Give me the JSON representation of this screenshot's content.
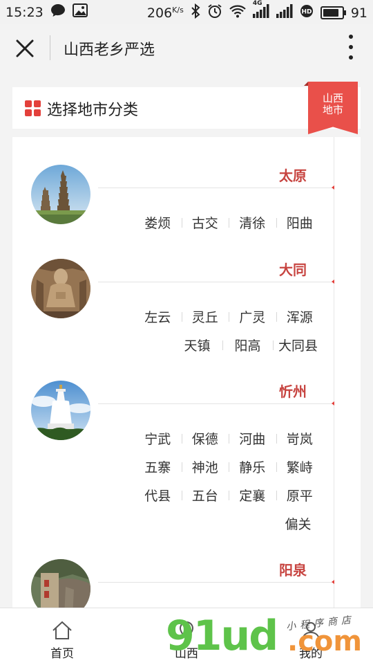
{
  "status_bar": {
    "time": "15:23",
    "speed": "206",
    "speed_unit": "K/s",
    "network": "4G",
    "battery": "91"
  },
  "nav": {
    "title": "山西老乡严选"
  },
  "section": {
    "title": "选择地市分类",
    "ribbon_line1": "山西",
    "ribbon_line2": "地市"
  },
  "cities": [
    {
      "name": "太原",
      "counties": [
        "娄烦",
        "古交",
        "清徐",
        "阳曲"
      ]
    },
    {
      "name": "大同",
      "counties": [
        "左云",
        "灵丘",
        "广灵",
        "浑源",
        "天镇",
        "阳高",
        "大同县"
      ]
    },
    {
      "name": "忻州",
      "counties": [
        "宁武",
        "保德",
        "河曲",
        "岢岚",
        "五寨",
        "神池",
        "静乐",
        "繁峙",
        "代县",
        "五台",
        "定襄",
        "原平",
        "偏关"
      ]
    },
    {
      "name": "阳泉",
      "counties": []
    }
  ],
  "tabs": [
    {
      "label": "首页",
      "icon": "home-icon"
    },
    {
      "label": "山西",
      "icon": "location-icon"
    },
    {
      "label": "我的",
      "icon": "user-icon"
    }
  ],
  "watermark": {
    "text": "91ud",
    "suffix": ".com",
    "small": "小程序商店"
  },
  "colors": {
    "accent": "#e3403b",
    "city_name": "#c74440",
    "ribbon": "#e9504a"
  }
}
